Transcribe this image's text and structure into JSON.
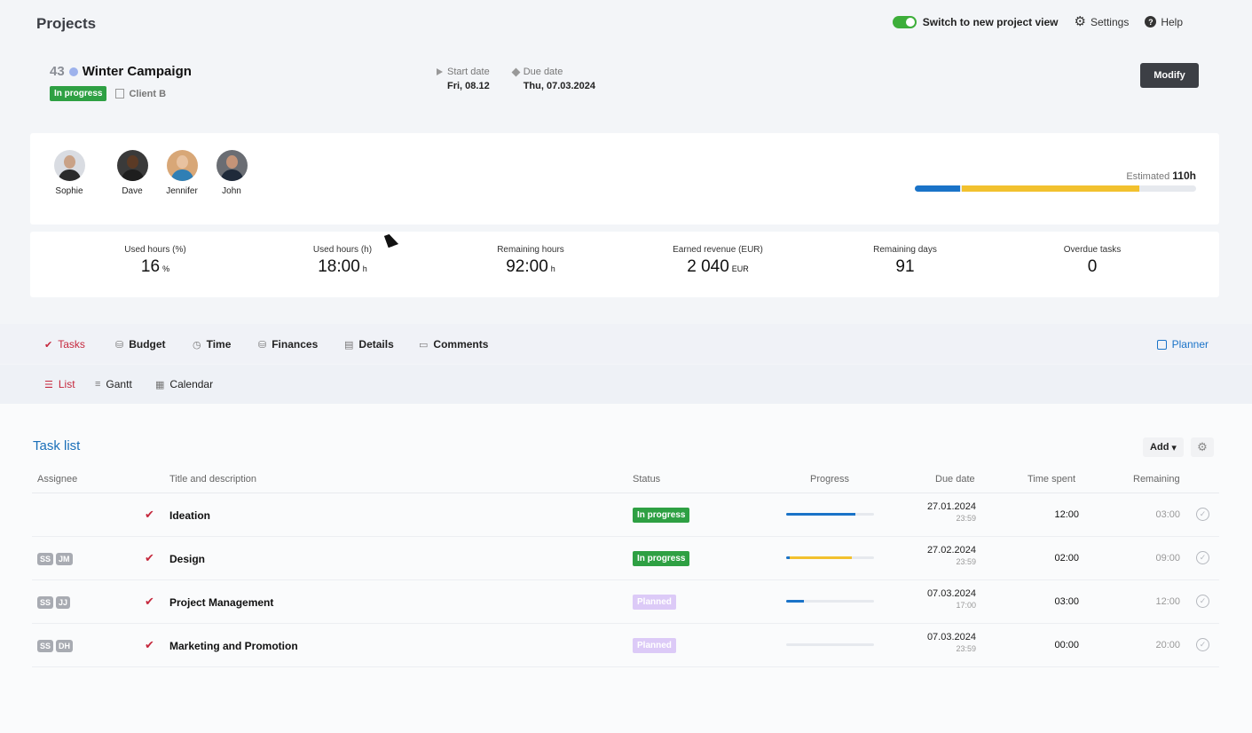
{
  "header": {
    "title": "Projects",
    "toggle_label": "Switch to new project view",
    "settings_label": "Settings",
    "help_label": "Help"
  },
  "project": {
    "number": "43",
    "name": "Winter Campaign",
    "status": "In progress",
    "client": "Client B",
    "start_label": "Start date",
    "start_value": "Fri, 08.12",
    "due_label": "Due date",
    "due_value": "Thu, 07.03.2024",
    "modify_label": "Modify"
  },
  "team": {
    "members": [
      {
        "name": "Sophie"
      },
      {
        "name": "Dave"
      },
      {
        "name": "Jennifer"
      },
      {
        "name": "John"
      }
    ],
    "estimated_label": "Estimated",
    "estimated_value": "110h",
    "estimated_used_fraction": 0.16,
    "estimated_planned_fraction": 0.63
  },
  "stats": [
    {
      "label": "Used hours (%)",
      "value": "16",
      "unit": "%"
    },
    {
      "label": "Used hours (h)",
      "value": "18:00",
      "unit": "h"
    },
    {
      "label": "Remaining hours",
      "value": "92:00",
      "unit": "h"
    },
    {
      "label": "Earned revenue (EUR)",
      "value": "2 040",
      "unit": "EUR"
    },
    {
      "label": "Remaining days",
      "value": "91",
      "unit": ""
    },
    {
      "label": "Overdue tasks",
      "value": "0",
      "unit": ""
    }
  ],
  "tabs": [
    {
      "label": "Tasks",
      "icon": "check-icon"
    },
    {
      "label": "Budget",
      "icon": "budget-icon"
    },
    {
      "label": "Time",
      "icon": "clock-icon"
    },
    {
      "label": "Finances",
      "icon": "finances-icon"
    },
    {
      "label": "Details",
      "icon": "document-icon"
    },
    {
      "label": "Comments",
      "icon": "comment-icon"
    }
  ],
  "planner_label": "Planner",
  "subtabs": [
    {
      "label": "List",
      "icon": "list-icon"
    },
    {
      "label": "Gantt",
      "icon": "gantt-icon"
    },
    {
      "label": "Calendar",
      "icon": "calendar-icon"
    }
  ],
  "tasklist": {
    "title": "Task list",
    "add_label": "Add",
    "columns": {
      "assignee": "Assignee",
      "title": "Title and description",
      "status": "Status",
      "progress": "Progress",
      "due": "Due date",
      "spent": "Time spent",
      "remaining": "Remaining"
    },
    "rows": [
      {
        "assignees": [],
        "title": "Ideation",
        "status": "In progress",
        "status_kind": "inprogress",
        "progress_used": 0.79,
        "progress_planned": 0,
        "due_date": "27.01.2024",
        "due_time": "23:59",
        "spent": "12:00",
        "remaining": "03:00"
      },
      {
        "assignees": [
          "SS",
          "JM"
        ],
        "title": "Design",
        "status": "In progress",
        "status_kind": "inprogress",
        "progress_used": 0.04,
        "progress_planned": 0.71,
        "due_date": "27.02.2024",
        "due_time": "23:59",
        "spent": "02:00",
        "remaining": "09:00"
      },
      {
        "assignees": [
          "SS",
          "JJ"
        ],
        "title": "Project Management",
        "status": "Planned",
        "status_kind": "planned",
        "progress_used": 0.2,
        "progress_planned": 0,
        "due_date": "07.03.2024",
        "due_time": "17:00",
        "spent": "03:00",
        "remaining": "12:00"
      },
      {
        "assignees": [
          "SS",
          "DH"
        ],
        "title": "Marketing and Promotion",
        "status": "Planned",
        "status_kind": "planned",
        "progress_used": 0,
        "progress_planned": 0,
        "due_date": "07.03.2024",
        "due_time": "23:59",
        "spent": "00:00",
        "remaining": "20:00"
      }
    ]
  },
  "colors": {
    "accent_red": "#c5283d",
    "accent_blue": "#1a73c8",
    "status_green": "#2ea043",
    "status_planned": "#dccaf7",
    "progress_yellow": "#f2c12e"
  }
}
